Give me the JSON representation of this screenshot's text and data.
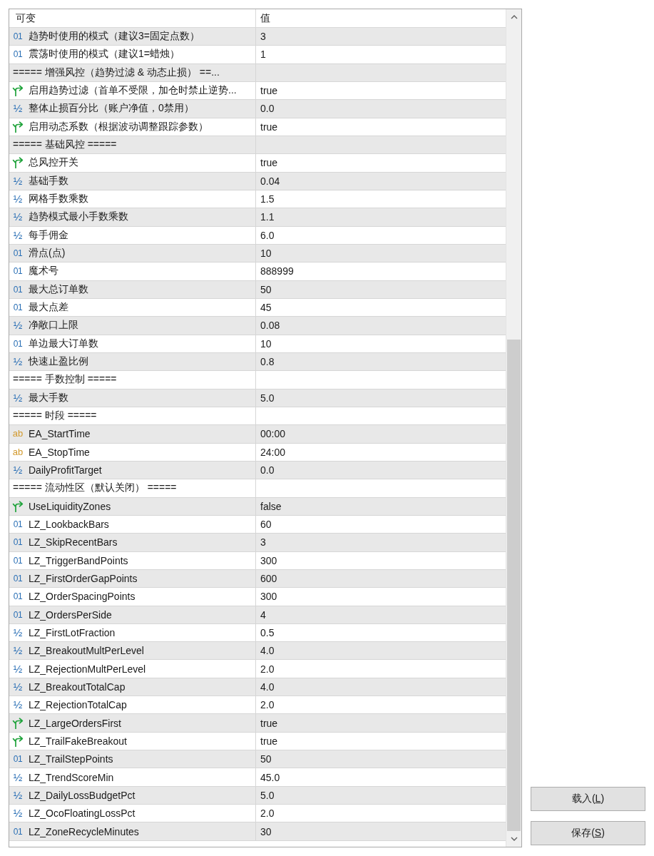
{
  "table": {
    "columns": [
      "可变",
      "值"
    ],
    "rows": [
      {
        "kind": "int",
        "mark": "01",
        "name": "趋势时使用的模式（建议3=固定点数）",
        "value": "3"
      },
      {
        "kind": "int",
        "mark": "01",
        "name": "震荡时使用的模式（建议1=蜡烛）",
        "value": "1"
      },
      {
        "kind": "separator",
        "name": "===== 增强风控（趋势过滤 & 动态止损） ==..."
      },
      {
        "kind": "bool",
        "name": "启用趋势过滤（首单不受限，加仓时禁止逆势...",
        "value": "true"
      },
      {
        "kind": "double",
        "mark": "½",
        "name": "整体止损百分比（账户净值，0禁用）",
        "value": "0.0"
      },
      {
        "kind": "bool",
        "name": "启用动态系数（根据波动调整跟踪参数）",
        "value": "true"
      },
      {
        "kind": "separator",
        "name": "===== 基础风控 ====="
      },
      {
        "kind": "bool",
        "name": "总风控开关",
        "value": "true"
      },
      {
        "kind": "double",
        "mark": "½",
        "name": "基础手数",
        "value": "0.04"
      },
      {
        "kind": "double",
        "mark": "½",
        "name": "网格手数乘数",
        "value": "1.5"
      },
      {
        "kind": "double",
        "mark": "½",
        "name": "趋势模式最小手数乘数",
        "value": "1.1"
      },
      {
        "kind": "double",
        "mark": "½",
        "name": "每手佣金",
        "value": "6.0"
      },
      {
        "kind": "int",
        "mark": "01",
        "name": "滑点(点)",
        "value": "10"
      },
      {
        "kind": "int",
        "mark": "01",
        "name": "魔术号",
        "value": "888999"
      },
      {
        "kind": "int",
        "mark": "01",
        "name": "最大总订单数",
        "value": "50"
      },
      {
        "kind": "int",
        "mark": "01",
        "name": "最大点差",
        "value": "45"
      },
      {
        "kind": "double",
        "mark": "½",
        "name": "净敞口上限",
        "value": "0.08"
      },
      {
        "kind": "int",
        "mark": "01",
        "name": "单边最大订单数",
        "value": "10"
      },
      {
        "kind": "double",
        "mark": "½",
        "name": "快速止盈比例",
        "value": "0.8"
      },
      {
        "kind": "separator",
        "name": "===== 手数控制 ====="
      },
      {
        "kind": "double",
        "mark": "½",
        "name": "最大手数",
        "value": "5.0"
      },
      {
        "kind": "separator",
        "name": "===== 时段 ====="
      },
      {
        "kind": "string",
        "mark": "ab",
        "name": "EA_StartTime",
        "value": "00:00"
      },
      {
        "kind": "string",
        "mark": "ab",
        "name": "EA_StopTime",
        "value": "24:00"
      },
      {
        "kind": "double",
        "mark": "½",
        "name": "DailyProfitTarget",
        "value": "0.0"
      },
      {
        "kind": "separator",
        "name": "===== 流动性区（默认关闭） ====="
      },
      {
        "kind": "bool",
        "name": "UseLiquidityZones",
        "value": "false"
      },
      {
        "kind": "int",
        "mark": "01",
        "name": "LZ_LookbackBars",
        "value": "60"
      },
      {
        "kind": "int",
        "mark": "01",
        "name": "LZ_SkipRecentBars",
        "value": "3"
      },
      {
        "kind": "int",
        "mark": "01",
        "name": "LZ_TriggerBandPoints",
        "value": "300"
      },
      {
        "kind": "int",
        "mark": "01",
        "name": "LZ_FirstOrderGapPoints",
        "value": "600"
      },
      {
        "kind": "int",
        "mark": "01",
        "name": "LZ_OrderSpacingPoints",
        "value": "300"
      },
      {
        "kind": "int",
        "mark": "01",
        "name": "LZ_OrdersPerSide",
        "value": "4"
      },
      {
        "kind": "double",
        "mark": "½",
        "name": "LZ_FirstLotFraction",
        "value": "0.5"
      },
      {
        "kind": "double",
        "mark": "½",
        "name": "LZ_BreakoutMultPerLevel",
        "value": "4.0"
      },
      {
        "kind": "double",
        "mark": "½",
        "name": "LZ_RejectionMultPerLevel",
        "value": "2.0"
      },
      {
        "kind": "double",
        "mark": "½",
        "name": "LZ_BreakoutTotalCap",
        "value": "4.0"
      },
      {
        "kind": "double",
        "mark": "½",
        "name": "LZ_RejectionTotalCap",
        "value": "2.0"
      },
      {
        "kind": "bool",
        "name": "LZ_LargeOrdersFirst",
        "value": "true"
      },
      {
        "kind": "bool",
        "name": "LZ_TrailFakeBreakout",
        "value": "true"
      },
      {
        "kind": "int",
        "mark": "01",
        "name": "LZ_TrailStepPoints",
        "value": "50"
      },
      {
        "kind": "double",
        "mark": "½",
        "name": "LZ_TrendScoreMin",
        "value": "45.0"
      },
      {
        "kind": "double",
        "mark": "½",
        "name": "LZ_DailyLossBudgetPct",
        "value": "5.0"
      },
      {
        "kind": "double",
        "mark": "½",
        "name": "LZ_OcoFloatingLossPct",
        "value": "2.0"
      },
      {
        "kind": "int",
        "mark": "01",
        "name": "LZ_ZoneRecycleMinutes",
        "value": "30"
      }
    ]
  },
  "buttons": [
    {
      "before": "载入(",
      "key": "L",
      "after": ")"
    },
    {
      "before": "保存(",
      "key": "S",
      "after": ")"
    }
  ]
}
